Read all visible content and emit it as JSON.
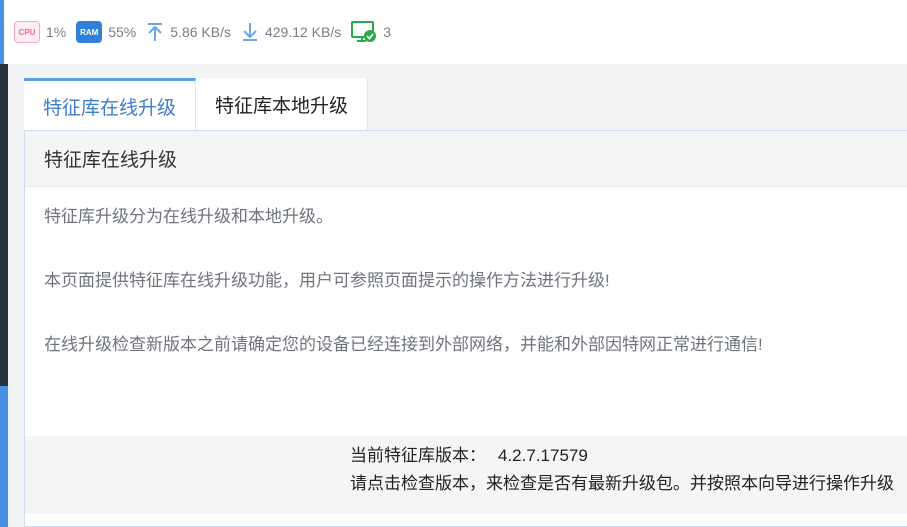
{
  "status": {
    "cpu": {
      "icon": "cpu-icon",
      "chip": "CPU",
      "value": "1%"
    },
    "ram": {
      "icon": "ram-icon",
      "chip": "RAM",
      "value": "55%"
    },
    "upload": {
      "icon": "upload-arrow-icon",
      "value": "5.86 KB/s"
    },
    "download": {
      "icon": "download-arrow-icon",
      "value": "429.12 KB/s"
    },
    "devices": {
      "icon": "monitor-check-icon",
      "value": "3"
    }
  },
  "tabs": [
    {
      "label": "特征库在线升级",
      "active": true
    },
    {
      "label": "特征库本地升级",
      "active": false
    }
  ],
  "panel": {
    "title": "特征库在线升级",
    "paragraphs": [
      "特征库升级分为在线升级和本地升级。",
      "本页面提供特征库在线升级功能，用户可参照页面提示的操作方法进行升级!",
      "在线升级检查新版本之前请确定您的设备已经连接到外部网络，并能和外部因特网正常进行通信!"
    ],
    "current_version_label": "当前特征库版本：",
    "current_version": "4.2.7.17579",
    "hint": "请点击检查版本，来检查是否有最新升级包。并按照本向导进行操作升级"
  },
  "colors": {
    "accent": "#4a90e2",
    "active_tab_text": "#3f7dc9",
    "ram_chip": "#2f80d8",
    "cpu_chip": "#e86b9e",
    "ok_green": "#2aa84a"
  }
}
